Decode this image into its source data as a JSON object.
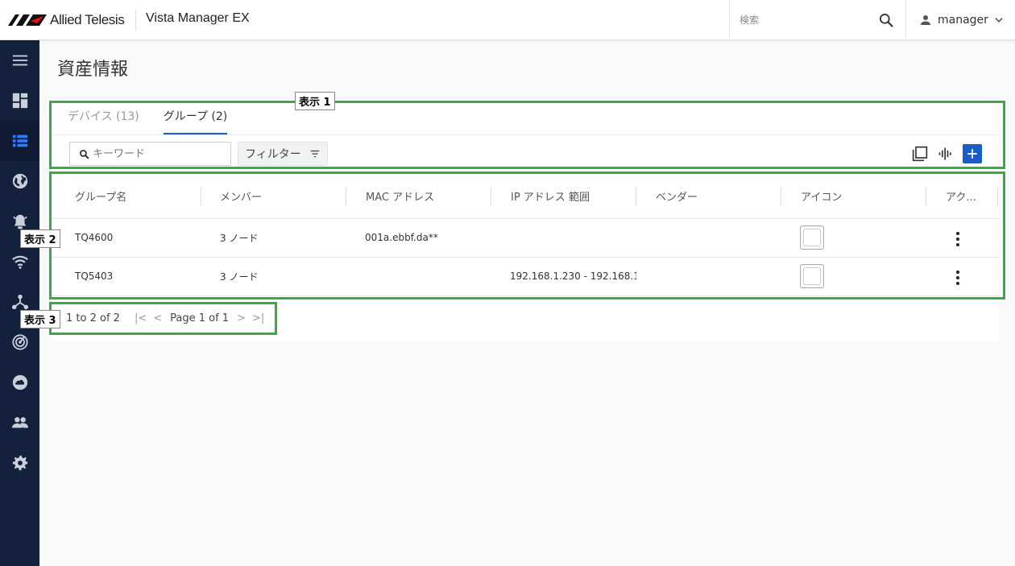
{
  "header": {
    "brand": "Allied Telesis",
    "product": "Vista Manager EX",
    "search_placeholder": "検索",
    "user": "manager"
  },
  "sidebar": {
    "items": [
      {
        "icon": "menu-icon"
      },
      {
        "icon": "dashboard-icon"
      },
      {
        "icon": "list-icon",
        "active": true
      },
      {
        "icon": "globe-icon"
      },
      {
        "icon": "alarm-icon"
      },
      {
        "icon": "wifi-icon"
      },
      {
        "icon": "topology-icon"
      },
      {
        "icon": "radar-icon"
      },
      {
        "icon": "cloud-icon"
      },
      {
        "icon": "users-icon"
      },
      {
        "icon": "gear-icon"
      }
    ]
  },
  "page": {
    "title": "資産情報"
  },
  "tabs": [
    {
      "label": "デバイス (13)",
      "active": false
    },
    {
      "label": "グループ (2)",
      "active": true
    }
  ],
  "toolbar": {
    "keyword_placeholder": "キーワード",
    "filter_label": "フィルター"
  },
  "table": {
    "columns": [
      "グループ名",
      "メンバー",
      "MAC アドレス",
      "IP アドレス 範囲",
      "ベンダー",
      "アイコン",
      "アク..."
    ],
    "rows": [
      {
        "name": "TQ4600",
        "members": "3 ノード",
        "mac": "001a.ebbf.da**",
        "ip": "",
        "vendor": ""
      },
      {
        "name": "TQ5403",
        "members": "3 ノード",
        "mac": "",
        "ip": "192.168.1.230 - 192.168.1.2",
        "vendor": ""
      }
    ]
  },
  "pagination": {
    "range": "1 to 2 of 2",
    "page_text": "Page 1 of 1",
    "first": "|<",
    "prev": "<",
    "next": ">",
    "last": ">|"
  },
  "annotations": {
    "label1": "表示 1",
    "label2": "表示 2",
    "label3": "表示 3"
  },
  "colors": {
    "sidebar_bg": "#14213d",
    "accent": "#1a5dc4",
    "annotation": "#3aaa47"
  }
}
